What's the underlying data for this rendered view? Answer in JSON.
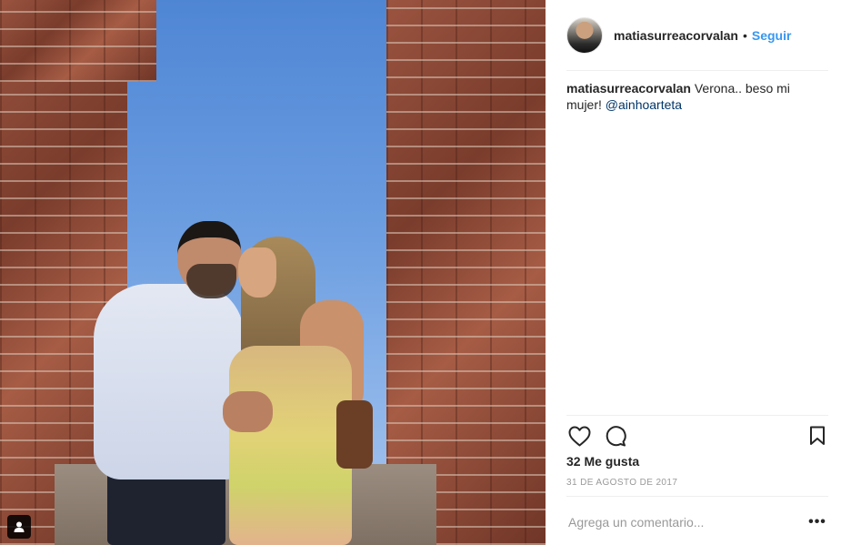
{
  "post": {
    "username": "matiasurreacorvalan",
    "separator": "•",
    "follow_label": "Seguir",
    "caption": {
      "username": "matiasurreacorvalan",
      "text": " Verona.. beso mi mujer! ",
      "mention": "@ainhoarteta"
    },
    "likes": "32 Me gusta",
    "date": "31 DE AGOSTO DE 2017",
    "comment_placeholder": "Agrega un comentario...",
    "more_label": "•••"
  },
  "icons": {
    "like": "heart-icon",
    "comment": "comment-bubble-icon",
    "save": "bookmark-icon",
    "tagged": "user-tag-icon"
  },
  "colors": {
    "link_blue": "#3897f0",
    "mention_blue": "#003569",
    "text": "#262626",
    "muted": "#999999",
    "divider": "#efefef"
  }
}
